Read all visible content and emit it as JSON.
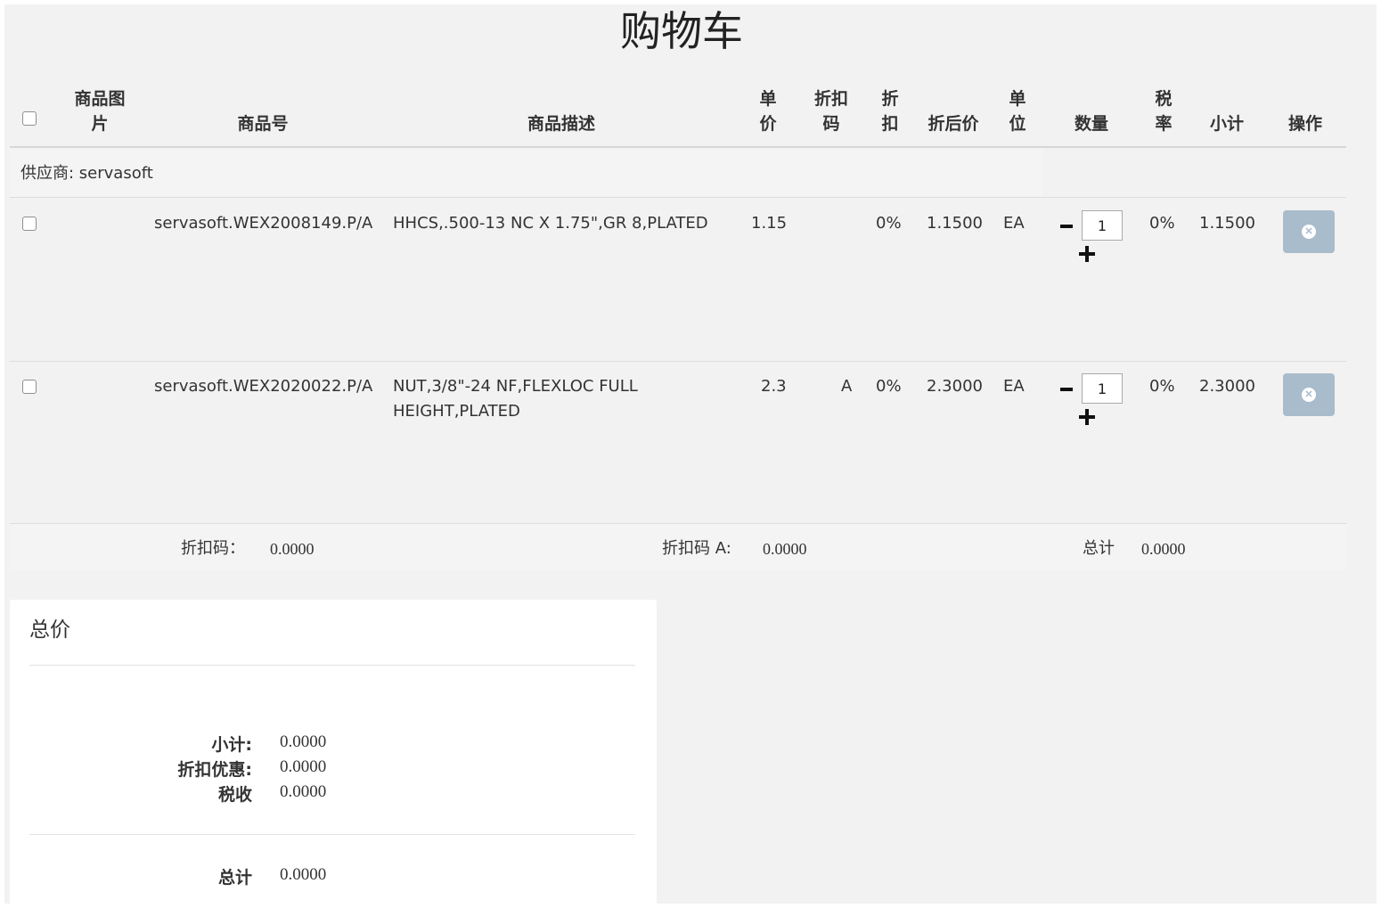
{
  "page_title": "购物车",
  "table_headers": {
    "image": "商品图片",
    "sku": "商品号",
    "description": "商品描述",
    "unit_price": "单价",
    "discount_code": "折扣码",
    "discount": "折扣",
    "discounted_price": "折后价",
    "unit": "单位",
    "quantity": "数量",
    "tax_rate": "税率",
    "subtotal": "小计",
    "actions": "操作"
  },
  "supplier_label": "供应商: servasoft",
  "rows": [
    {
      "sku": "servasoft.WEX2008149.P/A",
      "description": "HHCS,.500-13 NC X 1.75\",GR 8,PLATED",
      "unit_price": "1.15",
      "discount_code": "",
      "discount": "0%",
      "discounted_price": "1.1500",
      "unit": "EA",
      "quantity": "1",
      "tax_rate": "0%",
      "subtotal": "1.1500"
    },
    {
      "sku": "servasoft.WEX2020022.P/A",
      "description": "NUT,3/8\"-24 NF,FLEXLOC FULL HEIGHT,PLATED",
      "unit_price": "2.3",
      "discount_code": "A",
      "discount": "0%",
      "discounted_price": "2.3000",
      "unit": "EA",
      "quantity": "1",
      "tax_rate": "0%",
      "subtotal": "2.3000"
    }
  ],
  "footer": {
    "discount_code_label": "折扣码：",
    "discount_code_value": "0.0000",
    "discount_code_a_label": "折扣码 A:",
    "discount_code_a_value": "0.0000",
    "total_label": "总计",
    "total_value": "0.0000"
  },
  "summary": {
    "title": "总价",
    "subtotal_label": "小计:",
    "subtotal_value": "0.0000",
    "discount_label": "折扣优惠:",
    "discount_value": "0.0000",
    "tax_label": "税收",
    "tax_value": "0.0000",
    "total_label": "总计",
    "total_value": "0.0000"
  },
  "colors": {
    "background": "#f2f2f2",
    "delete_button": "#a9bccc",
    "summary_panel": "#ffffff"
  }
}
